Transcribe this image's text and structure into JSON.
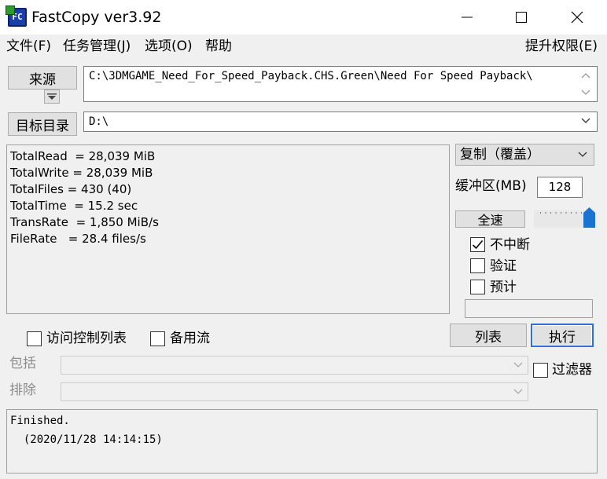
{
  "window": {
    "title": "FastCopy ver3.92",
    "icon_text": "FC"
  },
  "menu": {
    "file": "文件(F)",
    "jobs": "任务管理(J)",
    "options": "选项(O)",
    "help": "帮助",
    "elevate": "提升权限(E)"
  },
  "source": {
    "button": "来源",
    "path": "C:\\3DMGAME_Need_For_Speed_Payback.CHS.Green\\Need For Speed Payback\\"
  },
  "dest": {
    "button": "目标目录",
    "path": "D:\\"
  },
  "stats": [
    "TotalRead  = 28,039 MiB",
    "TotalWrite = 28,039 MiB",
    "TotalFiles = 430 (40)",
    "TotalTime  = 15.2 sec",
    "TransRate  = 1,850 MiB/s",
    "FileRate   = 28.4 files/s"
  ],
  "mode": {
    "selected": "复制（覆盖）"
  },
  "buffer": {
    "label": "缓冲区(MB)",
    "value": "128"
  },
  "speed": {
    "button": "全速",
    "level": 1.0
  },
  "checks": {
    "nonstop": {
      "label": "不中断",
      "checked": true
    },
    "verify": {
      "label": "验证",
      "checked": false
    },
    "estimate": {
      "label": "预计",
      "checked": false
    },
    "acl": {
      "label": "访问控制列表",
      "checked": false
    },
    "ads": {
      "label": "备用流",
      "checked": false
    },
    "filter": {
      "label": "过滤器",
      "checked": false
    }
  },
  "actions": {
    "list": "列表",
    "execute": "执行"
  },
  "include": {
    "label": "包括"
  },
  "exclude": {
    "label": "排除"
  },
  "log": {
    "line1": "Finished.",
    "line2": "  (2020/11/28 14:14:15)"
  },
  "colors": {
    "accent": "#2f6fd6",
    "slider_thumb": "#1a73d1",
    "check_mark": "#000000"
  }
}
